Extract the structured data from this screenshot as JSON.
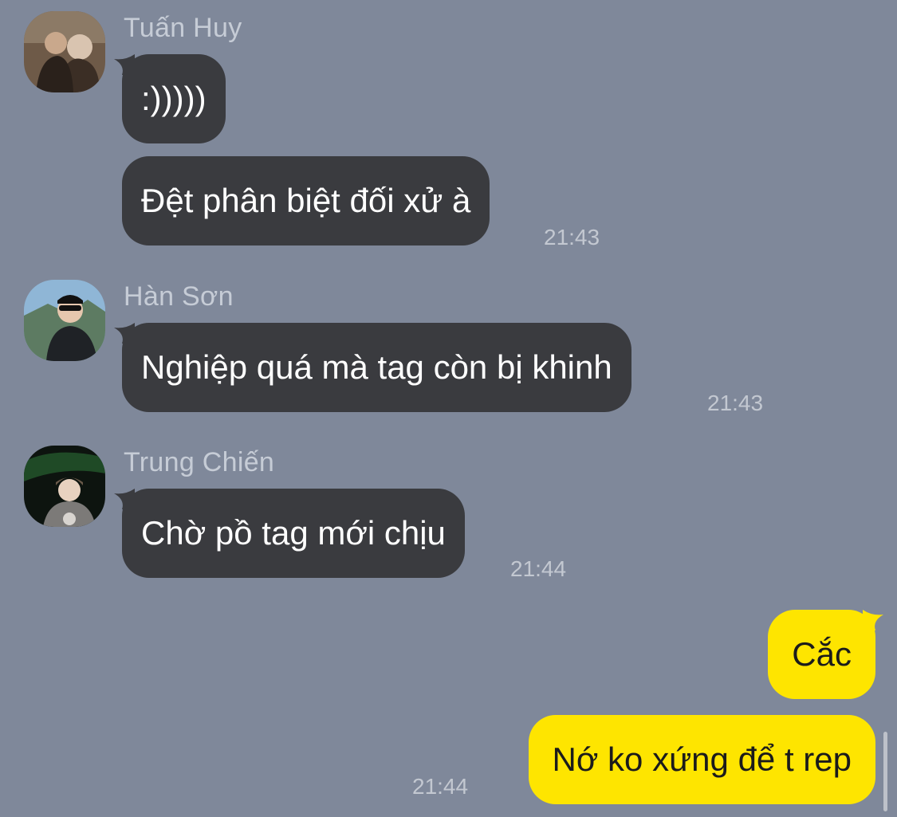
{
  "chat": {
    "messages": [
      {
        "sender": "Tuấn Huy",
        "avatar_icon": "avatar-tuan-huy",
        "bubbles": [
          ":)))))",
          "Đệt phân biệt đối xử à"
        ],
        "time": "21:43"
      },
      {
        "sender": "Hàn Sơn",
        "avatar_icon": "avatar-han-son",
        "bubbles": [
          "Nghiệp quá mà tag còn bị khinh"
        ],
        "time": "21:43"
      },
      {
        "sender": "Trung Chiến",
        "avatar_icon": "avatar-trung-chien",
        "bubbles": [
          "Chờ pồ tag mới chịu"
        ],
        "time": "21:44"
      }
    ],
    "my_messages": {
      "bubbles": [
        "Cắc",
        "Nớ ko xứng để t rep"
      ],
      "time": "21:44"
    }
  },
  "colors": {
    "background": "#7f889a",
    "incoming_bubble": "#3a3b3f",
    "outgoing_bubble": "#fee500"
  }
}
